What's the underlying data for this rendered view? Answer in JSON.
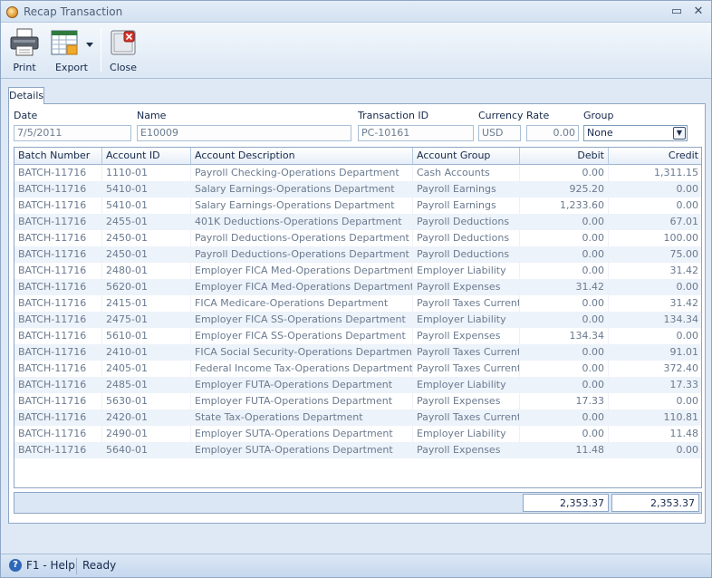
{
  "window": {
    "title": "Recap Transaction",
    "minimize_glyph": "▭",
    "close_glyph": "✕"
  },
  "toolbar": {
    "print_label": "Print",
    "export_label": "Export",
    "close_label": "Close"
  },
  "tabs": [
    {
      "label": "Details"
    }
  ],
  "fields": {
    "date": {
      "label": "Date",
      "value": "7/5/2011"
    },
    "name": {
      "label": "Name",
      "value": "E10009"
    },
    "transaction_id": {
      "label": "Transaction ID",
      "value": "PC-10161"
    },
    "currency": {
      "label": "Currency",
      "value": "USD"
    },
    "rate": {
      "label": "Rate",
      "value": "0.00"
    },
    "group": {
      "label": "Group",
      "value": "None"
    }
  },
  "grid": {
    "columns": [
      "Batch Number",
      "Account ID",
      "Account Description",
      "Account Group",
      "Debit",
      "Credit"
    ],
    "rows": [
      [
        "BATCH-11716",
        "1110-01",
        "Payroll Checking-Operations Department",
        "Cash Accounts",
        "0.00",
        "1,311.15"
      ],
      [
        "BATCH-11716",
        "5410-01",
        "Salary Earnings-Operations Department",
        "Payroll Earnings",
        "925.20",
        "0.00"
      ],
      [
        "BATCH-11716",
        "5410-01",
        "Salary Earnings-Operations Department",
        "Payroll Earnings",
        "1,233.60",
        "0.00"
      ],
      [
        "BATCH-11716",
        "2455-01",
        "401K Deductions-Operations Department",
        "Payroll Deductions",
        "0.00",
        "67.01"
      ],
      [
        "BATCH-11716",
        "2450-01",
        "Payroll Deductions-Operations Department",
        "Payroll Deductions",
        "0.00",
        "100.00"
      ],
      [
        "BATCH-11716",
        "2450-01",
        "Payroll Deductions-Operations Department",
        "Payroll Deductions",
        "0.00",
        "75.00"
      ],
      [
        "BATCH-11716",
        "2480-01",
        "Employer FICA Med-Operations Department",
        "Employer Liability",
        "0.00",
        "31.42"
      ],
      [
        "BATCH-11716",
        "5620-01",
        "Employer FICA Med-Operations Department",
        "Payroll Expenses",
        "31.42",
        "0.00"
      ],
      [
        "BATCH-11716",
        "2415-01",
        "FICA Medicare-Operations Department",
        "Payroll Taxes Current",
        "0.00",
        "31.42"
      ],
      [
        "BATCH-11716",
        "2475-01",
        "Employer FICA SS-Operations Department",
        "Employer Liability",
        "0.00",
        "134.34"
      ],
      [
        "BATCH-11716",
        "5610-01",
        "Employer FICA SS-Operations Department",
        "Payroll Expenses",
        "134.34",
        "0.00"
      ],
      [
        "BATCH-11716",
        "2410-01",
        "FICA Social Security-Operations Department",
        "Payroll Taxes Current",
        "0.00",
        "91.01"
      ],
      [
        "BATCH-11716",
        "2405-01",
        "Federal Income Tax-Operations Department",
        "Payroll Taxes Current",
        "0.00",
        "372.40"
      ],
      [
        "BATCH-11716",
        "2485-01",
        "Employer FUTA-Operations Department",
        "Employer Liability",
        "0.00",
        "17.33"
      ],
      [
        "BATCH-11716",
        "5630-01",
        "Employer FUTA-Operations Department",
        "Payroll Expenses",
        "17.33",
        "0.00"
      ],
      [
        "BATCH-11716",
        "2420-01",
        "State Tax-Operations Department",
        "Payroll Taxes Current",
        "0.00",
        "110.81"
      ],
      [
        "BATCH-11716",
        "2490-01",
        "Employer SUTA-Operations Department",
        "Employer Liability",
        "0.00",
        "11.48"
      ],
      [
        "BATCH-11716",
        "5640-01",
        "Employer SUTA-Operations Department",
        "Payroll Expenses",
        "11.48",
        "0.00"
      ]
    ],
    "totals": {
      "debit": "2,353.37",
      "credit": "2,353.37"
    }
  },
  "status": {
    "help_label": "F1 - Help",
    "state": "Ready"
  }
}
